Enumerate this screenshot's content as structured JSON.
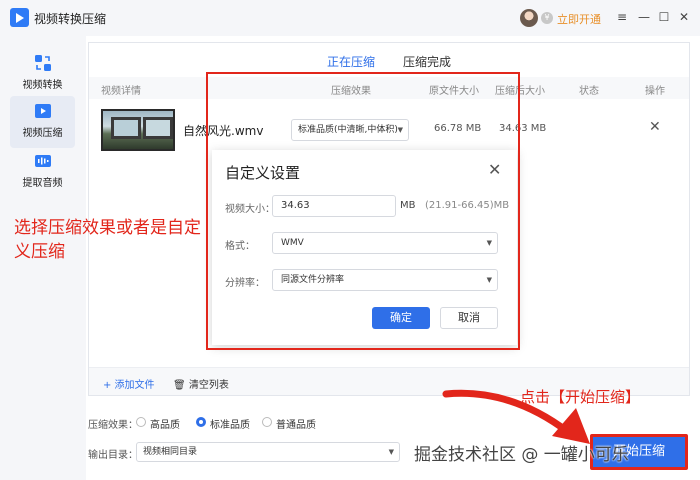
{
  "window": {
    "title": "视频转换压缩",
    "vip_label": "立即开通",
    "vip_icon": "vip-coin-icon",
    "controls": [
      "≡",
      "—",
      "☐",
      "✕"
    ]
  },
  "sidebar": {
    "items": [
      {
        "label": "视频转换",
        "icon": "video-convert-icon",
        "active": false
      },
      {
        "label": "视频压缩",
        "icon": "video-compress-icon",
        "active": true
      },
      {
        "label": "提取音频",
        "icon": "audio-extract-icon",
        "active": false
      }
    ]
  },
  "tabs": [
    {
      "label": "正在压缩",
      "active": true
    },
    {
      "label": "压缩完成",
      "active": false
    }
  ],
  "table": {
    "headers": {
      "details": "视频详情",
      "effect": "压缩效果",
      "orig_size": "原文件大小",
      "new_size": "压缩后大小",
      "status": "状态",
      "action": "操作"
    },
    "row": {
      "file_name": "自然风光.wmv",
      "quality": "标准品质(中清晰,中体积)",
      "orig_size": "66.78 MB",
      "new_size": "34.63 MB",
      "remove": "✕"
    }
  },
  "bottom_bar": {
    "add_file": "+ 添加文件",
    "clear_list": "清空列表"
  },
  "settings": {
    "effect_label": "压缩效果：",
    "options": [
      {
        "label": "高品质",
        "selected": false
      },
      {
        "label": "标准品质",
        "selected": true
      },
      {
        "label": "普通品质",
        "selected": false
      }
    ],
    "output_label": "输出目录：",
    "output_value": "视频相同目录"
  },
  "start_button": "开始压缩",
  "dialog": {
    "title": "自定义设置",
    "close": "✕",
    "size_label": "视频大小：",
    "size_value": "34.63",
    "size_unit": "MB",
    "size_range": "(21.91-66.45)MB",
    "format_label": "格式：",
    "format_value": "WMV",
    "resolution_label": "分辨率：",
    "resolution_value": "同源文件分辨率",
    "ok": "确定",
    "cancel": "取消"
  },
  "annotations": {
    "left_note": "选择压缩效果或者是自定义压缩",
    "click_note": "点击【开始压缩】",
    "watermark": "掘金技术社区 @ 一罐小可乐",
    "accent_color": "#e2261b"
  },
  "colors": {
    "primary": "#2f6fe8",
    "annotation": "#e2261b",
    "vip": "#e8902a"
  }
}
